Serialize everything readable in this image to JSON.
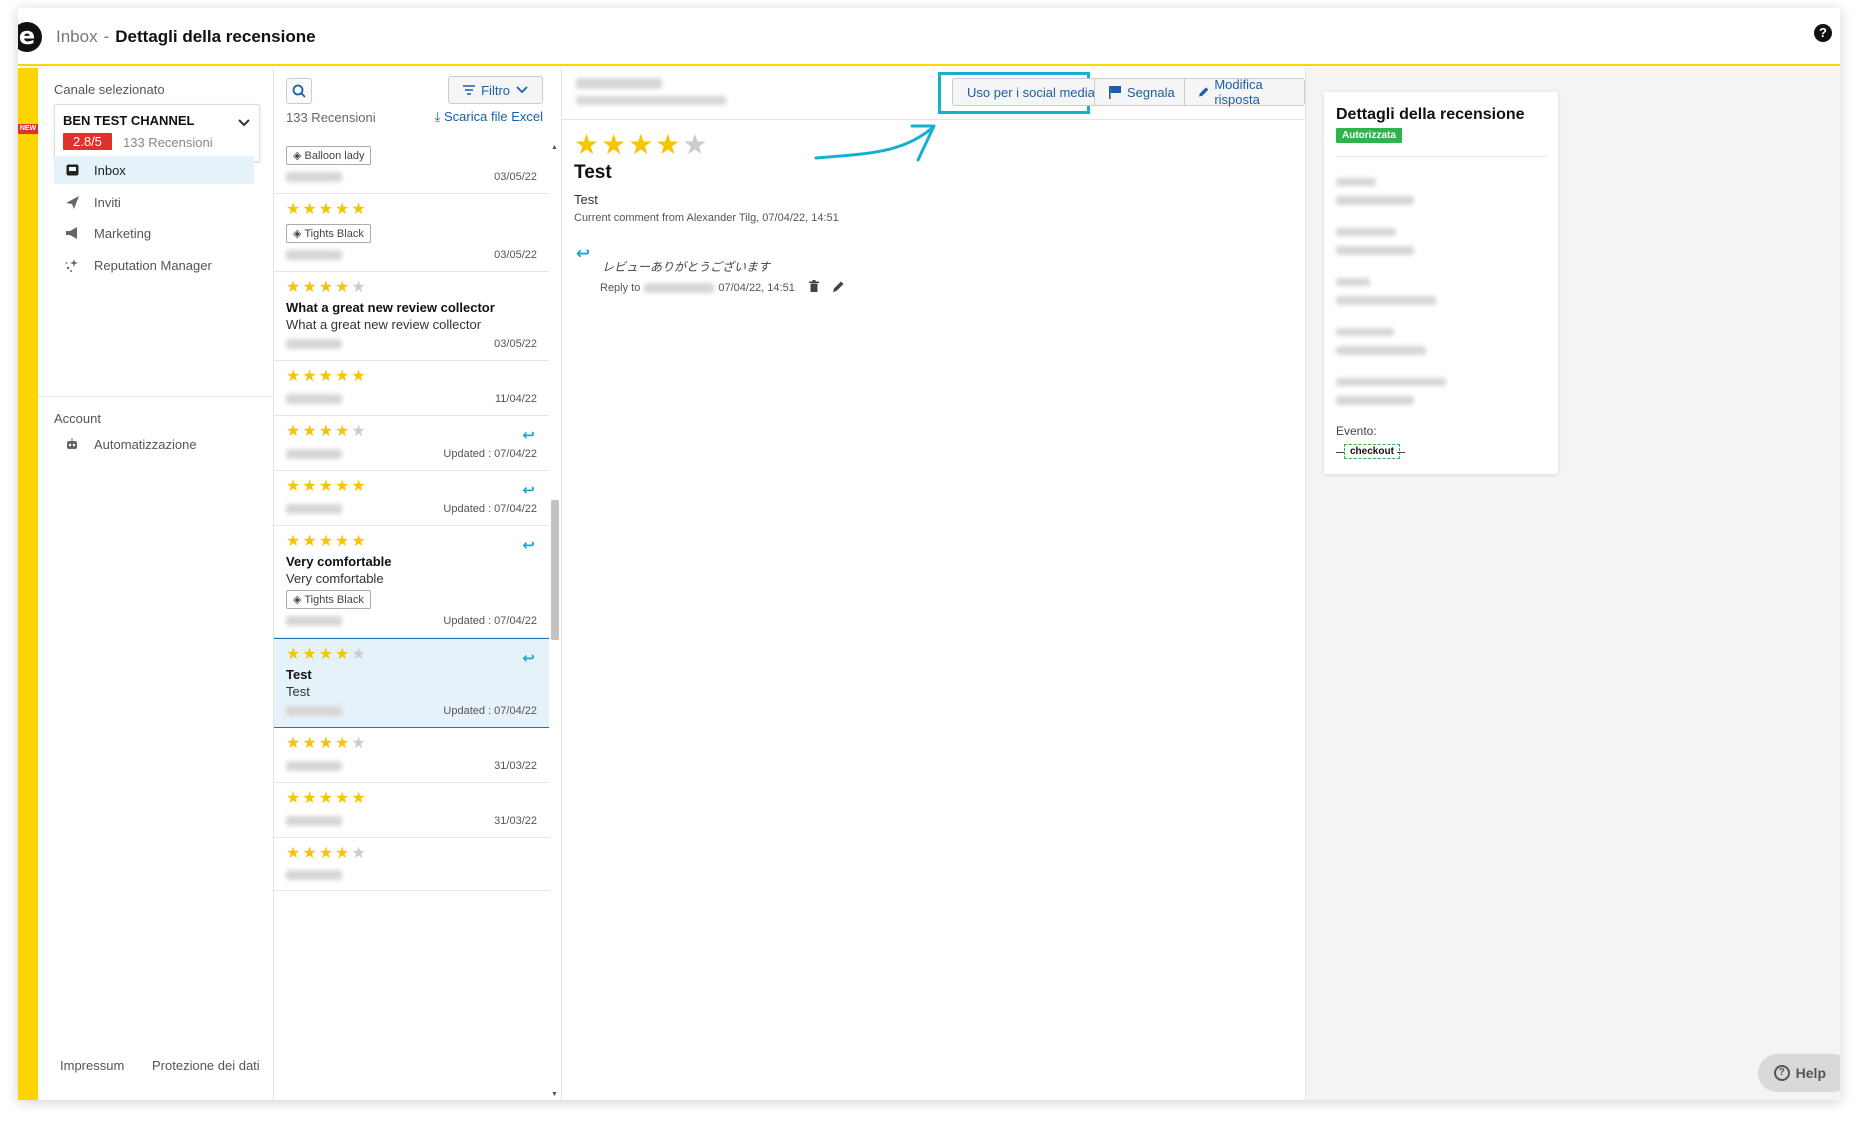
{
  "header": {
    "crumb_root": "Inbox",
    "crumb_sep": "-",
    "crumb_current": "Dettagli della recensione",
    "help_glyph": "?"
  },
  "strip": {
    "new_badge": "NEW"
  },
  "leftnav": {
    "channel_label": "Canale selezionato",
    "channel_name": "BEN TEST CHANNEL",
    "channel_score": "2.8/5",
    "channel_count": "133 Recensioni",
    "items": [
      {
        "label": "Inbox",
        "icon": "inbox-icon"
      },
      {
        "label": "Inviti",
        "icon": "send-icon"
      },
      {
        "label": "Marketing",
        "icon": "megaphone-icon"
      },
      {
        "label": "Reputation Manager",
        "icon": "sparkle-icon"
      }
    ],
    "account_label": "Account",
    "automation_label": "Automatizzazione",
    "footer_impressum": "Impressum",
    "footer_privacy": "Protezione dei dati"
  },
  "list": {
    "count": "133 Recensioni",
    "filter_label": "Filtro",
    "excel_label": "Scarica file Excel",
    "items": [
      {
        "rating": 0,
        "title": "",
        "body": "",
        "tag": "Balloon lady",
        "date": "03/05/22",
        "replied": false
      },
      {
        "rating": 5,
        "title": "",
        "body": "",
        "tag": "Tights Black",
        "date": "03/05/22",
        "replied": false
      },
      {
        "rating": 4,
        "title": "What a great new review collector",
        "body": "What a great new review collector",
        "tag": "",
        "date": "03/05/22",
        "replied": false
      },
      {
        "rating": 5,
        "title": "",
        "body": "",
        "tag": "",
        "date": "11/04/22",
        "replied": false
      },
      {
        "rating": 4,
        "title": "",
        "body": "",
        "tag": "",
        "date": "Updated : 07/04/22",
        "replied": true
      },
      {
        "rating": 5,
        "title": "",
        "body": "",
        "tag": "",
        "date": "Updated : 07/04/22",
        "replied": true
      },
      {
        "rating": 5,
        "title": "Very comfortable",
        "body": "Very comfortable",
        "tag": "Tights Black",
        "date": "Updated : 07/04/22",
        "replied": true
      },
      {
        "rating": 4,
        "title": "Test",
        "body": "Test",
        "tag": "",
        "date": "Updated : 07/04/22",
        "replied": true,
        "selected": true
      },
      {
        "rating": 4,
        "title": "",
        "body": "",
        "tag": "",
        "date": "31/03/22",
        "replied": false
      },
      {
        "rating": 5,
        "title": "",
        "body": "",
        "tag": "",
        "date": "31/03/22",
        "replied": false
      },
      {
        "rating": 4,
        "title": "",
        "body": "",
        "tag": "",
        "date": "",
        "replied": false
      }
    ]
  },
  "main": {
    "btn_social": "Uso per i social media",
    "btn_segnala": "Segnala",
    "btn_modifica": "Modifica risposta",
    "rating": 4,
    "title": "Test",
    "body": "Test",
    "comment_meta": "Current comment from Alexander Tilg, 07/04/22, 14:51",
    "reply_text": "レビューありがとうございます",
    "reply_to_label": "Reply to",
    "reply_date": "07/04/22, 14:51"
  },
  "details": {
    "title": "Dettagli della recensione",
    "status": "Autorizzata",
    "evento_label": "Evento:",
    "evento_value": "checkout"
  },
  "help": {
    "label": "Help"
  },
  "colors": {
    "accent": "#15b0d1",
    "brand_yellow": "#ffd500",
    "score_red": "#e0312f",
    "status_green": "#2fb34a",
    "link_blue": "#1a5fa8"
  }
}
